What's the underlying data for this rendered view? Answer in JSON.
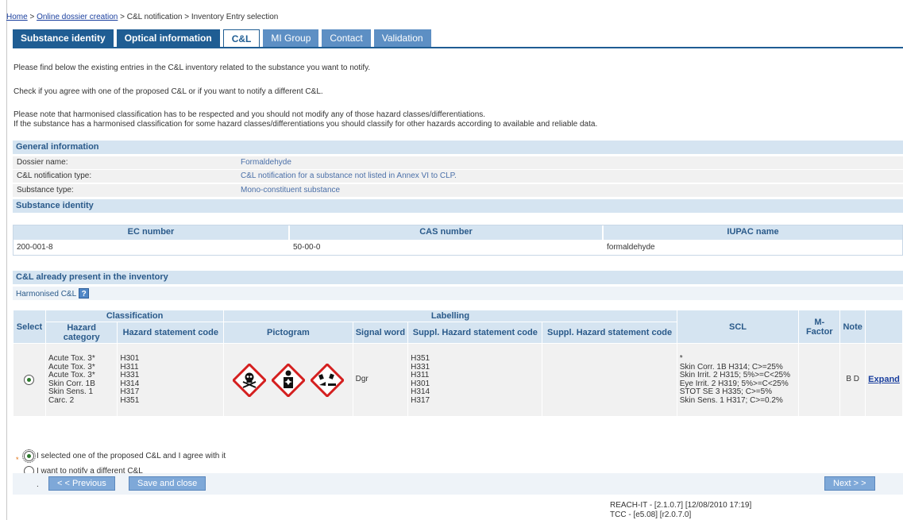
{
  "breadcrumb": {
    "home": "Home",
    "sep1": " > ",
    "online": "Online dossier creation",
    "rest": " > C&L notification > Inventory Entry selection"
  },
  "tabs": [
    {
      "label": "Substance identity"
    },
    {
      "label": "Optical information"
    },
    {
      "label": "C&L"
    },
    {
      "label": "MI Group"
    },
    {
      "label": "Contact"
    },
    {
      "label": "Validation"
    }
  ],
  "intro": {
    "line1": "Please find below the existing entries in the C&L inventory related to the substance you want to notify.",
    "line2": "Check if you agree with one of the proposed C&L or if you want to notify a different C&L.",
    "line3": "Please note that harmonised classification has to be respected and you should not modify any of those hazard classes/differentiations.",
    "line4": "If the substance has a harmonised classification for some hazard classes/differentiations you should classify for other hazards according to available and reliable data."
  },
  "general": {
    "title": "General information",
    "rows": [
      {
        "label": "Dossier name:",
        "value": "Formaldehyde"
      },
      {
        "label": "C&L notification type:",
        "value": "C&L notification for a substance not listed in Annex VI to CLP."
      },
      {
        "label": "Substance type:",
        "value": "Mono-constituent substance"
      }
    ]
  },
  "identity": {
    "title": "Substance identity",
    "headers": [
      "EC number",
      "CAS number",
      "IUPAC name"
    ],
    "values": [
      "200-001-8",
      "50-00-0",
      "formaldehyde"
    ]
  },
  "inventory": {
    "title": "C&L already present in the inventory",
    "harmonised_label": "Harmonised C&L",
    "help": "?",
    "headers": {
      "select": "Select",
      "classification": "Classification",
      "labelling": "Labelling",
      "scl": "SCL",
      "mfactor": "M-Factor",
      "note": "Note",
      "hazard_category": "Hazard category",
      "hazard_statement": "Hazard statement code",
      "pictogram": "Pictogram",
      "signal_word": "Signal word",
      "suppl1": "Suppl. Hazard statement code",
      "suppl2": "Suppl. Hazard statement code"
    },
    "row": {
      "hazard_categories": [
        "Acute Tox. 3*",
        "Acute Tox. 3*",
        "Acute Tox. 3*",
        "Skin Corr. 1B",
        "Skin Sens. 1",
        "Carc. 2"
      ],
      "hazard_statements": [
        "H301",
        "H311",
        "H331",
        "H314",
        "H317",
        "H351"
      ],
      "pictograms": [
        "skull-crossbones-icon",
        "health-hazard-icon",
        "corrosion-icon"
      ],
      "signal_word": "Dgr",
      "suppl_hazard": [
        "H351",
        "H331",
        "H311",
        "H301",
        "H314",
        "H317"
      ],
      "scl": [
        "*",
        "Skin Corr. 1B H314; C>=25%",
        "Skin Irrit. 2 H315; 5%>=C<25%",
        "Eye Irrit. 2 H319; 5%>=C<25%",
        "STOT SE 3 H335; C>=5%",
        "Skin Sens. 1 H317; C>=0.2%"
      ],
      "note": "B D",
      "expand": "Expand"
    }
  },
  "options": {
    "agree": "I selected one of the proposed C&L and I agree with it",
    "different": "I want to notify a different C&L"
  },
  "buttons": {
    "previous": "< < Previous",
    "save": "Save and close",
    "next": "Next > >"
  },
  "footer": {
    "line1": "REACH-IT - [2.1.0.7] [12/08/2010 17:19]",
    "line2": "TCC - [e5.08] [r2.0.7.0]"
  }
}
